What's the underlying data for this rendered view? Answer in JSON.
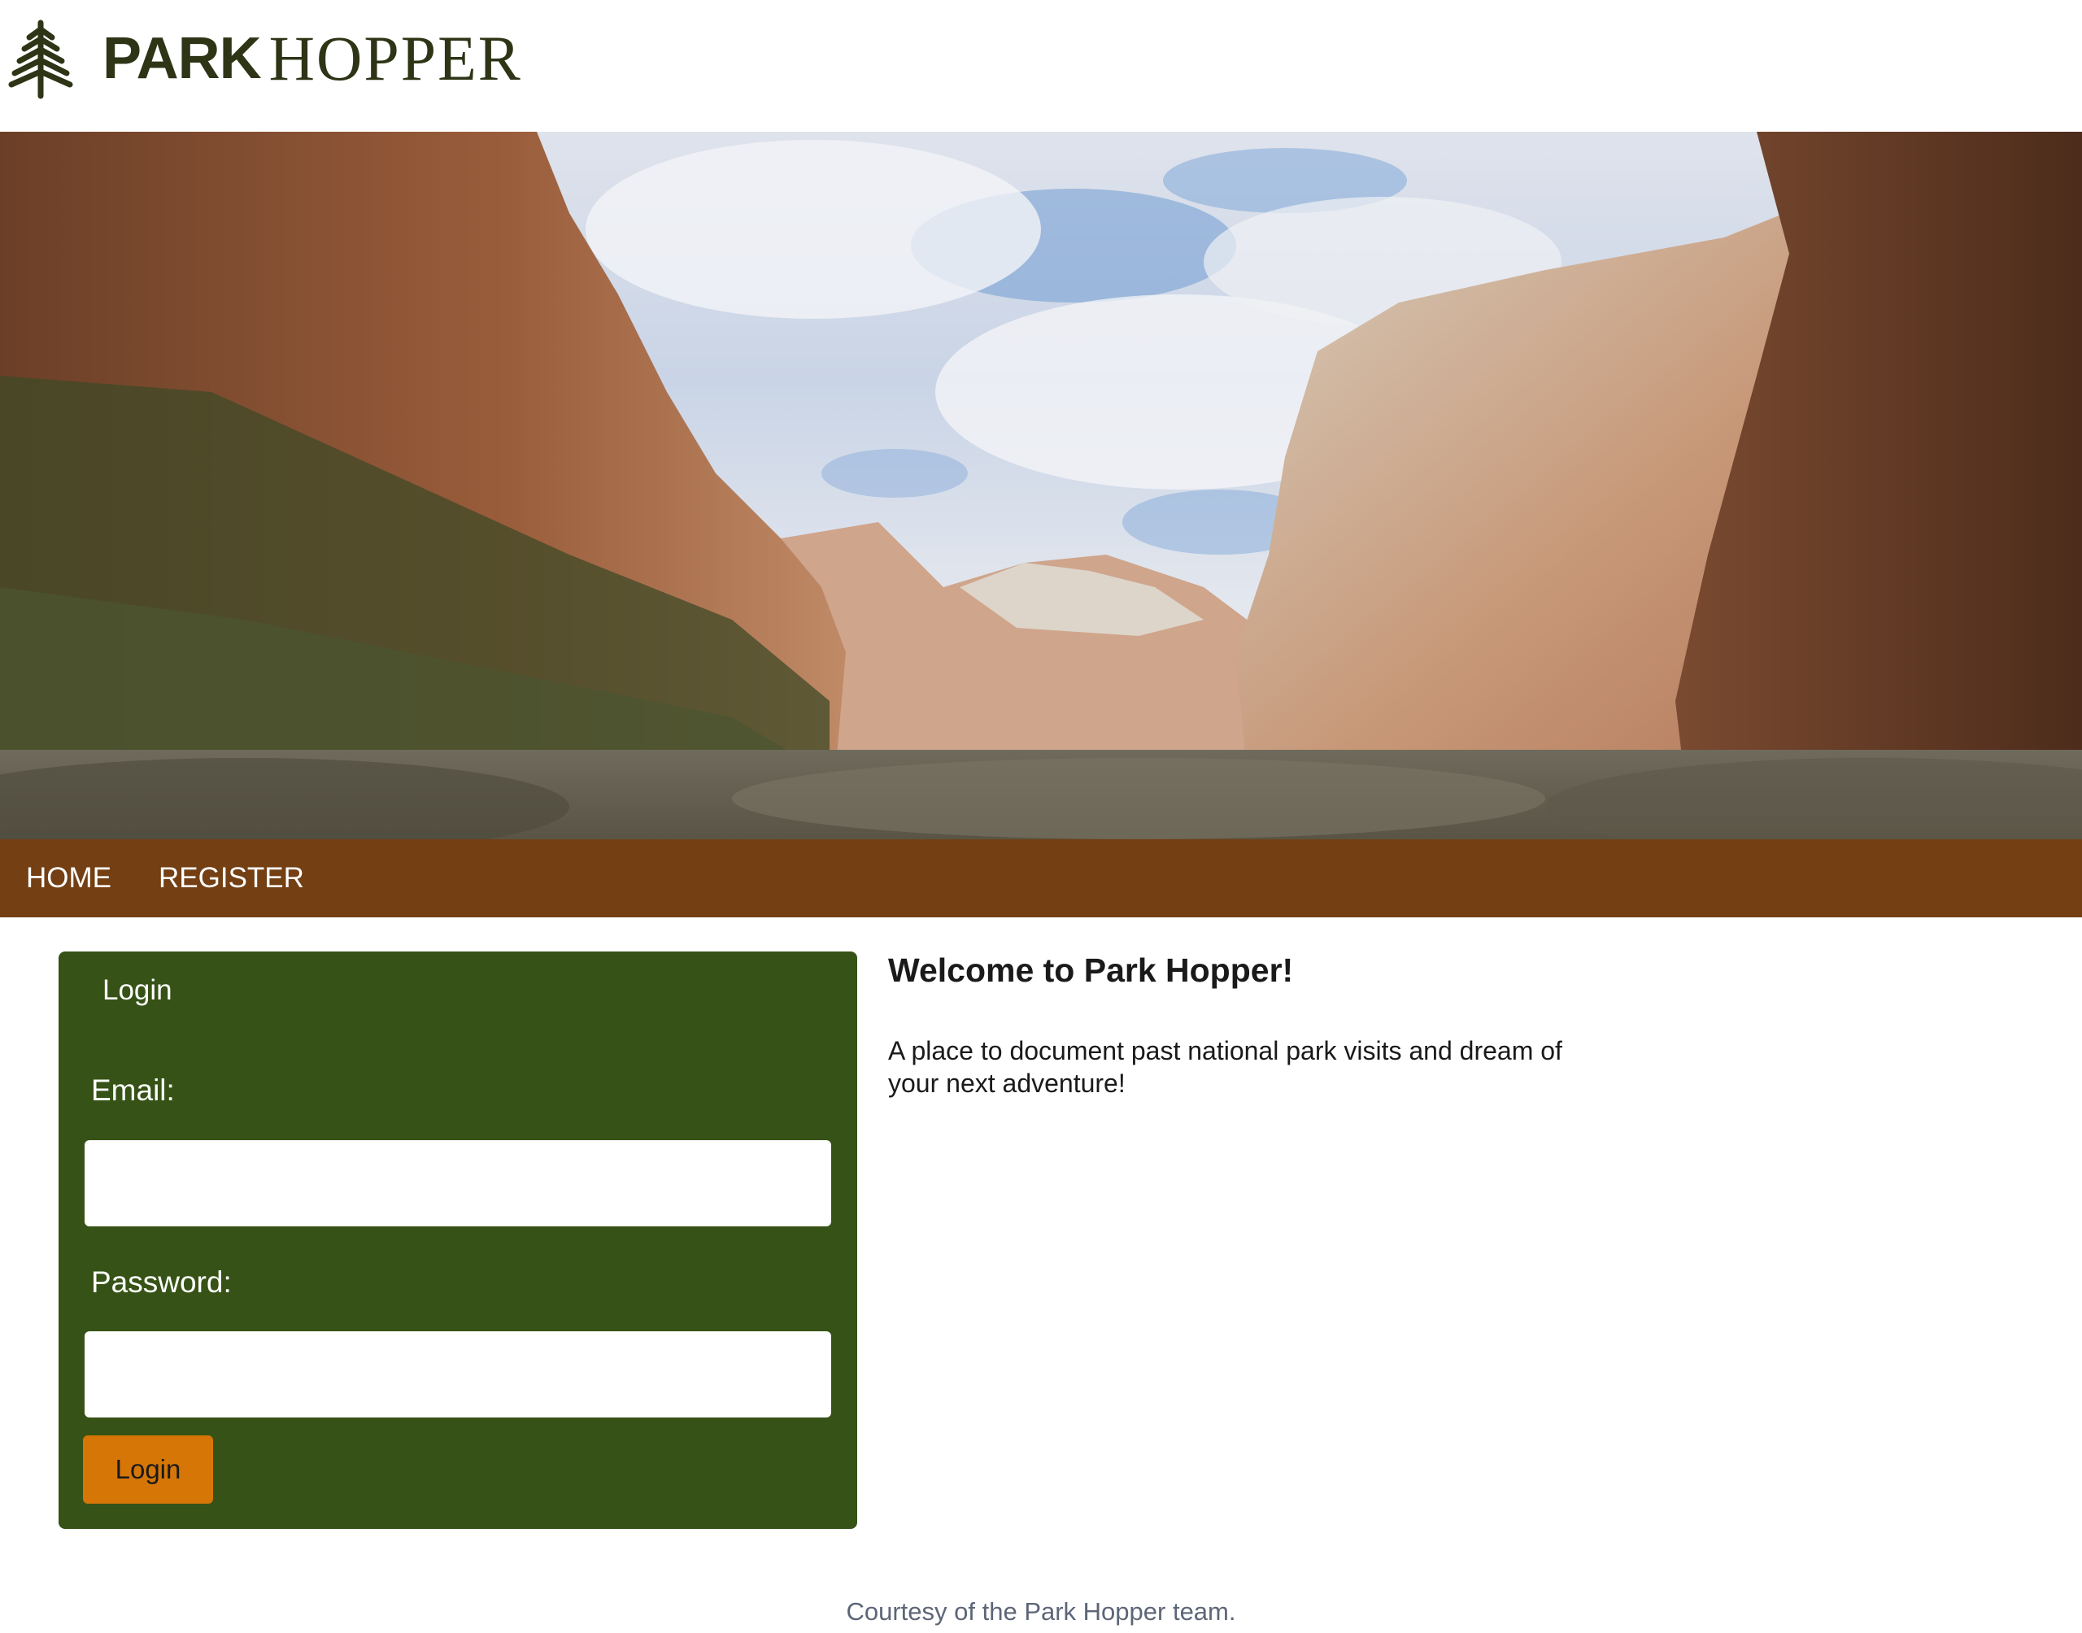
{
  "header": {
    "logo_bold": "PARK",
    "logo_light": "HOPPER",
    "logo_icon": "pine-tree-icon"
  },
  "hero": {
    "image_subject": "canyon-landscape"
  },
  "nav": {
    "items": [
      {
        "label": "HOME"
      },
      {
        "label": "REGISTER"
      }
    ]
  },
  "login": {
    "title": "Login",
    "email_label": "Email:",
    "email_value": "",
    "password_label": "Password:",
    "password_value": "",
    "button_label": "Login"
  },
  "welcome": {
    "title": "Welcome to Park Hopper!",
    "text": "A place to document past national park visits and dream of your next adventure!"
  },
  "footer": {
    "text": "Courtesy of the Park Hopper team."
  },
  "colors": {
    "nav_bg": "#733f13",
    "card_bg": "#365216",
    "button_bg": "#d67607",
    "logo": "#2d3516"
  }
}
